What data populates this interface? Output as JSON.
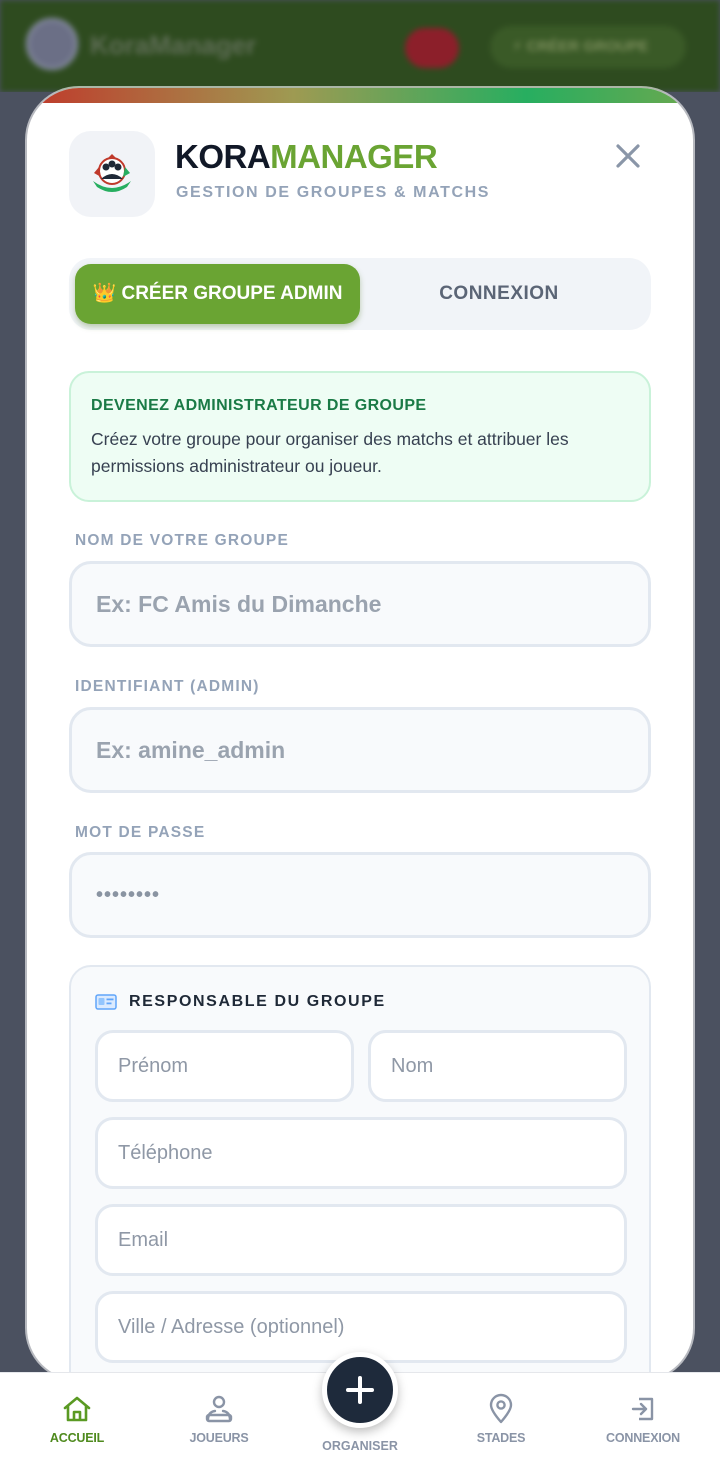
{
  "background": {
    "app_title": "KoraManager",
    "header_pill": "⚡ CRÉER GROUPE"
  },
  "modal": {
    "brand_part1": "KORA",
    "brand_part2": "MANAGER",
    "subtitle": "GESTION DE GROUPES & MATCHS",
    "tabs": [
      {
        "label": "👑 CRÉER GROUPE ADMIN",
        "active": true
      },
      {
        "label": "CONNEXION",
        "active": false
      }
    ],
    "info": {
      "title": "DEVENEZ ADMINISTRATEUR DE GROUPE",
      "text": "Créez votre groupe pour organiser des matchs et attribuer les permissions administrateur ou joueur."
    },
    "fields": {
      "group_name": {
        "label": "NOM DE VOTRE GROUPE",
        "placeholder": "Ex: FC Amis du Dimanche",
        "value": ""
      },
      "identifier": {
        "label": "IDENTIFIANT (ADMIN)",
        "placeholder": "Ex: amine_admin",
        "value": ""
      },
      "password": {
        "label": "MOT DE PASSE",
        "masked_value": "••••••••"
      }
    },
    "responsable": {
      "title": "RESPONSABLE DU GROUPE",
      "icon": "id-card-icon",
      "firstname_placeholder": "Prénom",
      "lastname_placeholder": "Nom",
      "phone_placeholder": "Téléphone",
      "email_placeholder": "Email",
      "address_placeholder": "Ville / Adresse (optionnel)"
    }
  },
  "nav": {
    "items": [
      {
        "label": "ACCUEIL",
        "icon": "home-icon",
        "active": true
      },
      {
        "label": "JOUEURS",
        "icon": "users-icon",
        "active": false
      },
      {
        "label": "ORGANISER",
        "icon": "plus-icon",
        "active": false
      },
      {
        "label": "STADES",
        "icon": "map-pin-icon",
        "active": false
      },
      {
        "label": "CONNEXION",
        "icon": "login-icon",
        "active": false
      }
    ]
  },
  "colors": {
    "accent_green": "#6aa433",
    "dark_navy": "#1e2a3b",
    "info_green": "#1a7a46"
  }
}
